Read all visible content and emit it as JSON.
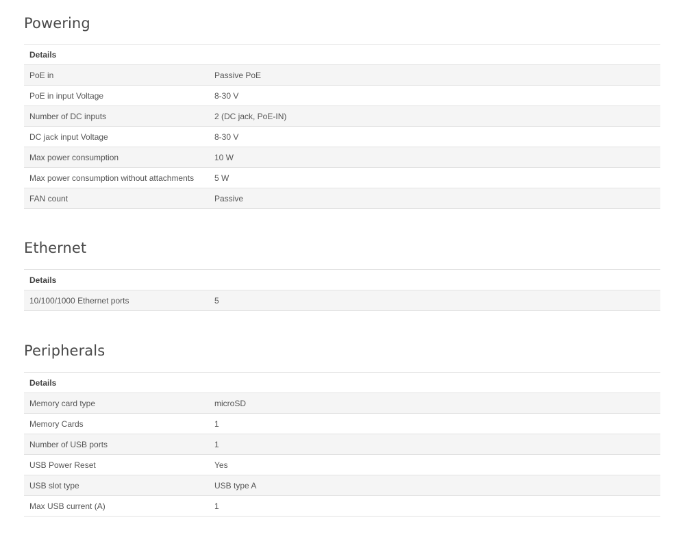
{
  "sections": [
    {
      "title": "Powering",
      "header": "Details",
      "rows": [
        {
          "label": "PoE in",
          "value": "Passive PoE"
        },
        {
          "label": "PoE in input Voltage",
          "value": "8-30 V"
        },
        {
          "label": "Number of DC inputs",
          "value": "2 (DC jack, PoE-IN)"
        },
        {
          "label": "DC jack input Voltage",
          "value": "8-30 V"
        },
        {
          "label": "Max power consumption",
          "value": "10 W"
        },
        {
          "label": "Max power consumption without attachments",
          "value": "5 W"
        },
        {
          "label": "FAN count",
          "value": "Passive"
        }
      ]
    },
    {
      "title": "Ethernet",
      "header": "Details",
      "rows": [
        {
          "label": "10/100/1000 Ethernet ports",
          "value": "5"
        }
      ]
    },
    {
      "title": "Peripherals",
      "header": "Details",
      "rows": [
        {
          "label": "Memory card type",
          "value": "microSD"
        },
        {
          "label": "Memory Cards",
          "value": "1"
        },
        {
          "label": "Number of USB ports",
          "value": "1"
        },
        {
          "label": "USB Power Reset",
          "value": "Yes"
        },
        {
          "label": "USB slot type",
          "value": "USB type A"
        },
        {
          "label": "Max USB current (A)",
          "value": "1"
        }
      ]
    }
  ]
}
